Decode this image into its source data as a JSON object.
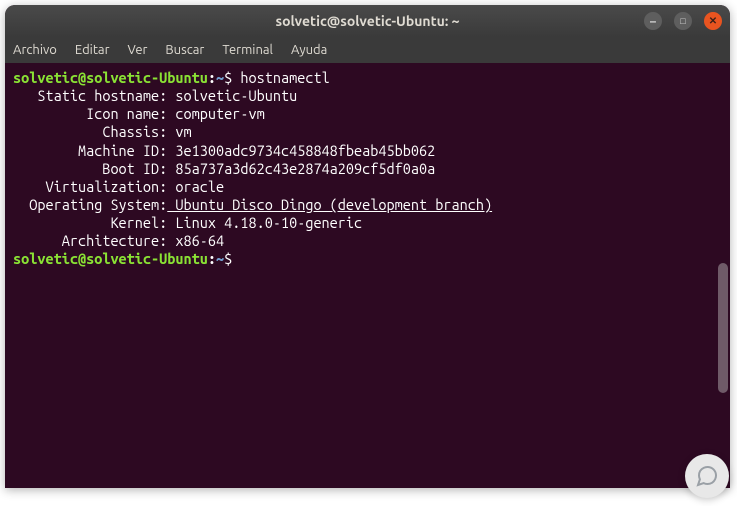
{
  "titlebar": {
    "title": "solvetic@solvetic-Ubuntu: ~"
  },
  "menubar": {
    "items": [
      "Archivo",
      "Editar",
      "Ver",
      "Buscar",
      "Terminal",
      "Ayuda"
    ]
  },
  "prompt": {
    "user_host": "solvetic@solvetic-Ubuntu",
    "colon": ":",
    "path": "~",
    "sigil": "$"
  },
  "command": "hostnamectl",
  "output": {
    "lines": [
      {
        "label": "   Static hostname:",
        "value": " solvetic-Ubuntu"
      },
      {
        "label": "         Icon name:",
        "value": " computer-vm"
      },
      {
        "label": "           Chassis:",
        "value": " vm"
      },
      {
        "label": "        Machine ID:",
        "value": " 3e1300adc9734c458848fbeab45bb062"
      },
      {
        "label": "           Boot ID:",
        "value": " 85a737a3d62c43e2874a209cf5df0a0a"
      },
      {
        "label": "    Virtualization:",
        "value": " oracle"
      },
      {
        "label": "  Operating System:",
        "value": " Ubuntu Disco Dingo (development branch)",
        "underline": true
      },
      {
        "label": "            Kernel:",
        "value": " Linux 4.18.0-10-generic"
      },
      {
        "label": "      Architecture:",
        "value": " x86-64"
      }
    ]
  }
}
